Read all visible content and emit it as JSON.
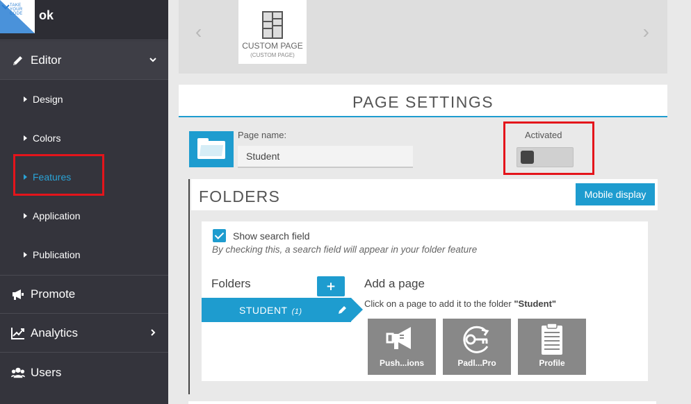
{
  "app": {
    "name": "ok",
    "logo_text": "TAKE YOUR CODE"
  },
  "sidebar": {
    "editor": {
      "label": "Editor"
    },
    "sub_items": [
      {
        "label": "Design"
      },
      {
        "label": "Colors"
      },
      {
        "label": "Features",
        "active": true
      },
      {
        "label": "Application"
      },
      {
        "label": "Publication"
      }
    ],
    "promote": {
      "label": "Promote"
    },
    "analytics": {
      "label": "Analytics"
    },
    "users": {
      "label": "Users"
    }
  },
  "carousel": {
    "prev_glyph": "‹",
    "next_glyph": "›",
    "page": {
      "title": "CUSTOM PAGE",
      "subtitle": "(CUSTOM PAGE)"
    }
  },
  "page_settings": {
    "title": "PAGE SETTINGS",
    "page_name_label": "Page name:",
    "page_name_value": "Student",
    "activated_label": "Activated"
  },
  "folders": {
    "title": "FOLDERS",
    "mobile_display_label": "Mobile display",
    "show_search_label": "Show search field",
    "show_search_help": "By checking this, a search field will appear in your folder feature",
    "folders_label": "Folders",
    "add_folder_glyph": "+",
    "items": [
      {
        "name": "STUDENT",
        "count": "(1)"
      }
    ],
    "add_page": {
      "title": "Add a page",
      "help_prefix": "Click on a page to add it to the folder ",
      "help_folder": "\"Student\""
    },
    "tiles": [
      {
        "label": "Push...ions",
        "icon": "megaphone-icon"
      },
      {
        "label": "Padl...Pro",
        "icon": "padlock-key-icon"
      },
      {
        "label": "Profile",
        "icon": "clipboard-icon"
      }
    ]
  },
  "colors": {
    "accent": "#1e9ccf",
    "sidebar_bg": "#34343c",
    "highlight": "#e4141b",
    "tile_bg": "#888888"
  }
}
